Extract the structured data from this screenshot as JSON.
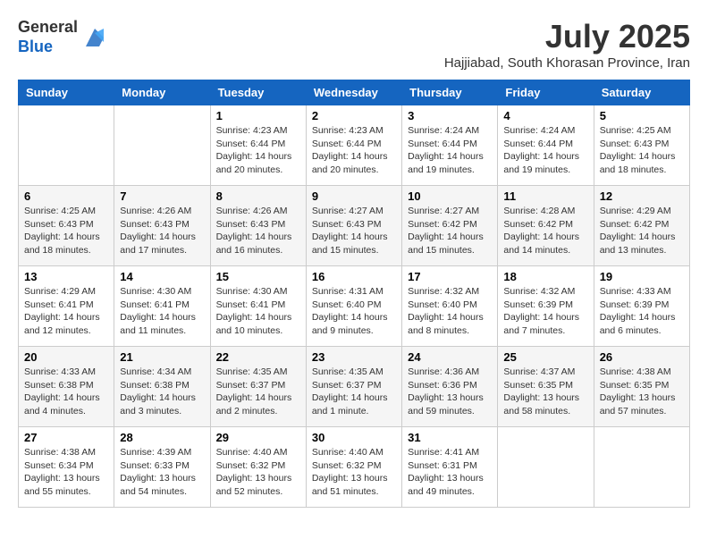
{
  "header": {
    "logo_line1": "General",
    "logo_line2": "Blue",
    "month_year": "July 2025",
    "location": "Hajjiabad, South Khorasan Province, Iran"
  },
  "days_of_week": [
    "Sunday",
    "Monday",
    "Tuesday",
    "Wednesday",
    "Thursday",
    "Friday",
    "Saturday"
  ],
  "weeks": [
    [
      {
        "day": "",
        "info": ""
      },
      {
        "day": "",
        "info": ""
      },
      {
        "day": "1",
        "info": "Sunrise: 4:23 AM\nSunset: 6:44 PM\nDaylight: 14 hours and 20 minutes."
      },
      {
        "day": "2",
        "info": "Sunrise: 4:23 AM\nSunset: 6:44 PM\nDaylight: 14 hours and 20 minutes."
      },
      {
        "day": "3",
        "info": "Sunrise: 4:24 AM\nSunset: 6:44 PM\nDaylight: 14 hours and 19 minutes."
      },
      {
        "day": "4",
        "info": "Sunrise: 4:24 AM\nSunset: 6:44 PM\nDaylight: 14 hours and 19 minutes."
      },
      {
        "day": "5",
        "info": "Sunrise: 4:25 AM\nSunset: 6:43 PM\nDaylight: 14 hours and 18 minutes."
      }
    ],
    [
      {
        "day": "6",
        "info": "Sunrise: 4:25 AM\nSunset: 6:43 PM\nDaylight: 14 hours and 18 minutes."
      },
      {
        "day": "7",
        "info": "Sunrise: 4:26 AM\nSunset: 6:43 PM\nDaylight: 14 hours and 17 minutes."
      },
      {
        "day": "8",
        "info": "Sunrise: 4:26 AM\nSunset: 6:43 PM\nDaylight: 14 hours and 16 minutes."
      },
      {
        "day": "9",
        "info": "Sunrise: 4:27 AM\nSunset: 6:43 PM\nDaylight: 14 hours and 15 minutes."
      },
      {
        "day": "10",
        "info": "Sunrise: 4:27 AM\nSunset: 6:42 PM\nDaylight: 14 hours and 15 minutes."
      },
      {
        "day": "11",
        "info": "Sunrise: 4:28 AM\nSunset: 6:42 PM\nDaylight: 14 hours and 14 minutes."
      },
      {
        "day": "12",
        "info": "Sunrise: 4:29 AM\nSunset: 6:42 PM\nDaylight: 14 hours and 13 minutes."
      }
    ],
    [
      {
        "day": "13",
        "info": "Sunrise: 4:29 AM\nSunset: 6:41 PM\nDaylight: 14 hours and 12 minutes."
      },
      {
        "day": "14",
        "info": "Sunrise: 4:30 AM\nSunset: 6:41 PM\nDaylight: 14 hours and 11 minutes."
      },
      {
        "day": "15",
        "info": "Sunrise: 4:30 AM\nSunset: 6:41 PM\nDaylight: 14 hours and 10 minutes."
      },
      {
        "day": "16",
        "info": "Sunrise: 4:31 AM\nSunset: 6:40 PM\nDaylight: 14 hours and 9 minutes."
      },
      {
        "day": "17",
        "info": "Sunrise: 4:32 AM\nSunset: 6:40 PM\nDaylight: 14 hours and 8 minutes."
      },
      {
        "day": "18",
        "info": "Sunrise: 4:32 AM\nSunset: 6:39 PM\nDaylight: 14 hours and 7 minutes."
      },
      {
        "day": "19",
        "info": "Sunrise: 4:33 AM\nSunset: 6:39 PM\nDaylight: 14 hours and 6 minutes."
      }
    ],
    [
      {
        "day": "20",
        "info": "Sunrise: 4:33 AM\nSunset: 6:38 PM\nDaylight: 14 hours and 4 minutes."
      },
      {
        "day": "21",
        "info": "Sunrise: 4:34 AM\nSunset: 6:38 PM\nDaylight: 14 hours and 3 minutes."
      },
      {
        "day": "22",
        "info": "Sunrise: 4:35 AM\nSunset: 6:37 PM\nDaylight: 14 hours and 2 minutes."
      },
      {
        "day": "23",
        "info": "Sunrise: 4:35 AM\nSunset: 6:37 PM\nDaylight: 14 hours and 1 minute."
      },
      {
        "day": "24",
        "info": "Sunrise: 4:36 AM\nSunset: 6:36 PM\nDaylight: 13 hours and 59 minutes."
      },
      {
        "day": "25",
        "info": "Sunrise: 4:37 AM\nSunset: 6:35 PM\nDaylight: 13 hours and 58 minutes."
      },
      {
        "day": "26",
        "info": "Sunrise: 4:38 AM\nSunset: 6:35 PM\nDaylight: 13 hours and 57 minutes."
      }
    ],
    [
      {
        "day": "27",
        "info": "Sunrise: 4:38 AM\nSunset: 6:34 PM\nDaylight: 13 hours and 55 minutes."
      },
      {
        "day": "28",
        "info": "Sunrise: 4:39 AM\nSunset: 6:33 PM\nDaylight: 13 hours and 54 minutes."
      },
      {
        "day": "29",
        "info": "Sunrise: 4:40 AM\nSunset: 6:32 PM\nDaylight: 13 hours and 52 minutes."
      },
      {
        "day": "30",
        "info": "Sunrise: 4:40 AM\nSunset: 6:32 PM\nDaylight: 13 hours and 51 minutes."
      },
      {
        "day": "31",
        "info": "Sunrise: 4:41 AM\nSunset: 6:31 PM\nDaylight: 13 hours and 49 minutes."
      },
      {
        "day": "",
        "info": ""
      },
      {
        "day": "",
        "info": ""
      }
    ]
  ]
}
